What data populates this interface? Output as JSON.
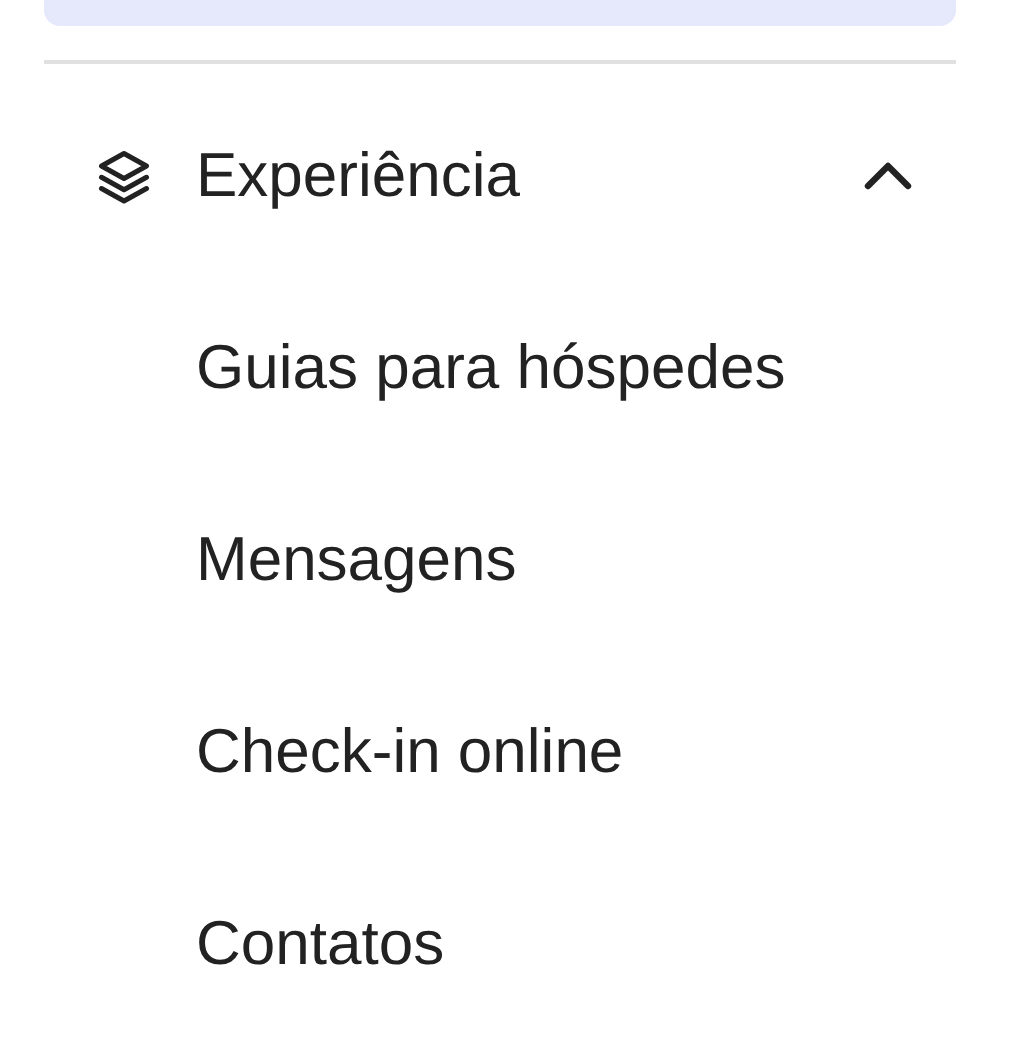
{
  "section": {
    "title": "Experiência",
    "expanded": true,
    "items": [
      {
        "label": "Guias para hóspedes"
      },
      {
        "label": "Mensagens"
      },
      {
        "label": "Check-in online"
      },
      {
        "label": "Contatos"
      }
    ]
  }
}
